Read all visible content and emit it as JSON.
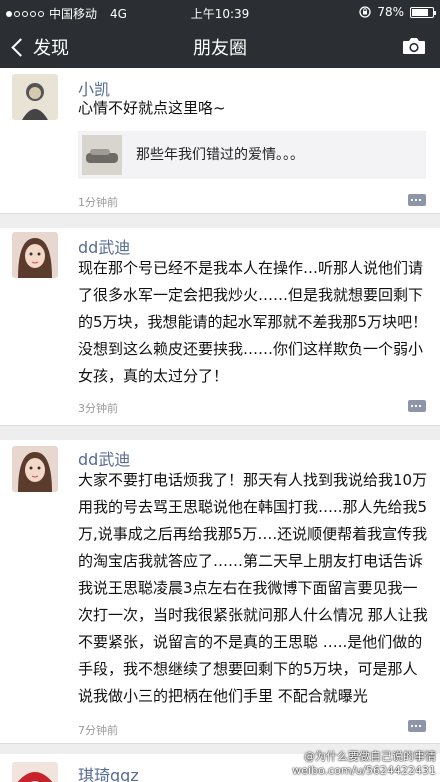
{
  "status": {
    "carrier": "中国移动",
    "network": "4G",
    "time": "上午10:39",
    "battery_text": "78%",
    "battery_level": 0.78
  },
  "nav": {
    "back_label": "发现",
    "title": "朋友圈"
  },
  "posts": [
    {
      "name": "小凯",
      "text": "心情不好就点这里咯~",
      "link_title": "那些年我们错过的爱情。。。",
      "time": "1分钟前"
    },
    {
      "name": "dd武迪",
      "text": "现在那个号已经不是我本人在操作…听那人说他们请了很多水军一定会把我炒火……但是我就想要回剩下的5万块，我想能请的起水军那就不差我那5万块吧！没想到这么赖皮还要挟我……你们这样欺负一个弱小女孩，真的太过分了！",
      "time": "3分钟前"
    },
    {
      "name": "dd武迪",
      "text": "大家不要打电话烦我了！那天有人找到我说给我10万用我的号去骂王思聪说他在韩国打我…..那人先给我5万,说事成之后再给我那5万….还说顺便帮着我宣传我的淘宝店我就答应了……第二天早上朋友打电话告诉我说王思聪凌晨3点左右在我微博下面留言要见我一次打一次，当时我很紧张就问那人什么情况 那人让我不要紧张，说留言的不是真的王思聪 …..是他们做的手段，我不想继续了想要回剩下的5万块，可是那人说我做小三的把柄在他们手里 不配合就曝光",
      "time": "7分钟前"
    },
    {
      "name": "琪琦qqz"
    }
  ],
  "watermark": {
    "line1": "@为什么要做自己说的事情",
    "line2": "weibo.com/u/5624422431"
  }
}
